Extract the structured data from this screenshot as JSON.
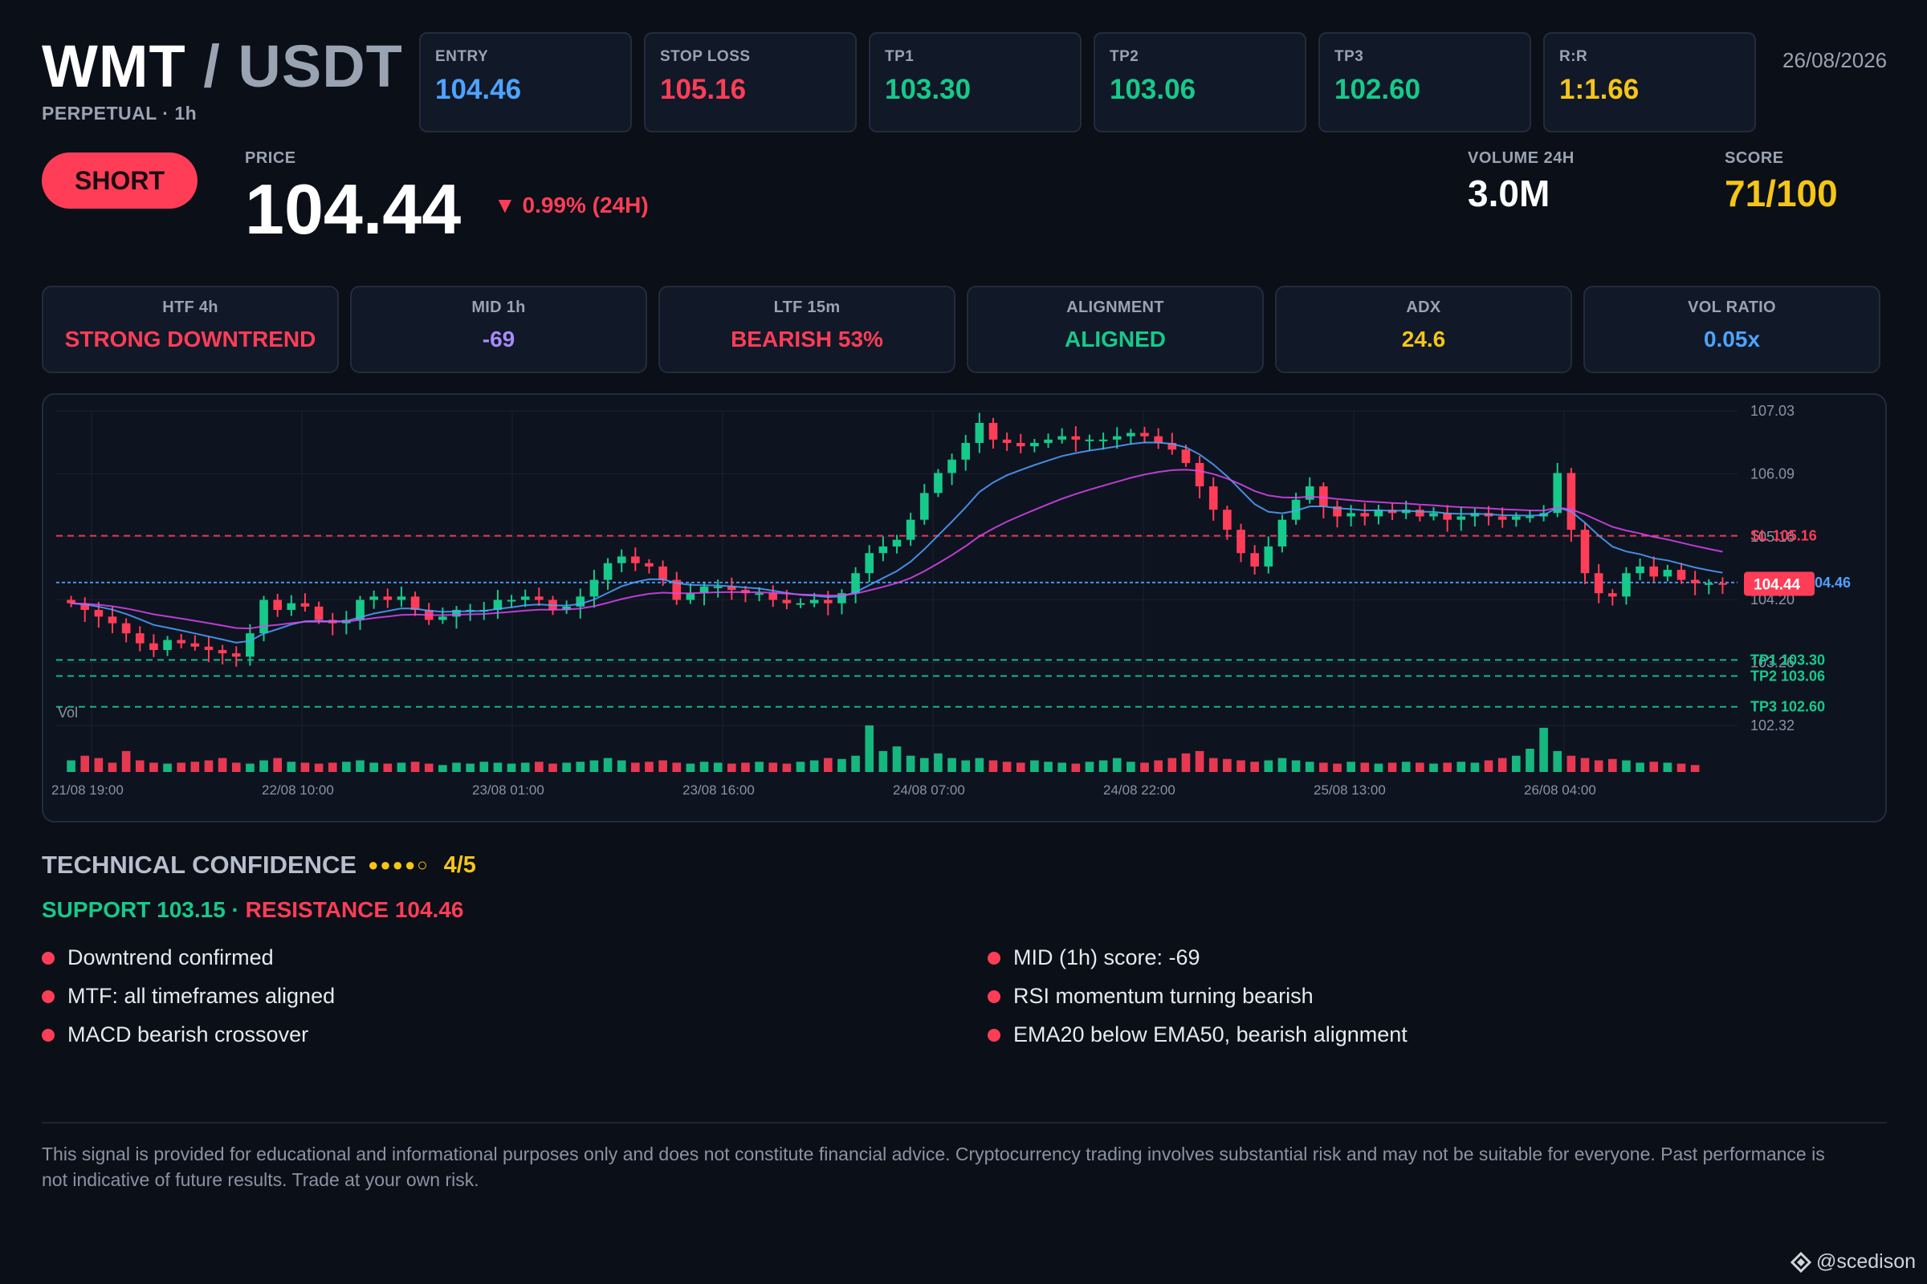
{
  "header": {
    "base": "WMT",
    "slash": "/",
    "quote": "USDT",
    "subtitle": "PERPETUAL · 1h",
    "date": "26/08/2026"
  },
  "top_cards": [
    {
      "label": "ENTRY",
      "value": "104.46",
      "color": "#4ea3ff"
    },
    {
      "label": "STOP LOSS",
      "value": "105.16",
      "color": "#ff3d57"
    },
    {
      "label": "TP1",
      "value": "103.30",
      "color": "#17c98a"
    },
    {
      "label": "TP2",
      "value": "103.06",
      "color": "#17c98a"
    },
    {
      "label": "TP3",
      "value": "102.60",
      "color": "#17c98a"
    },
    {
      "label": "R:R",
      "value": "1:1.66",
      "color": "#f5c518"
    }
  ],
  "signal": {
    "direction": "SHORT",
    "price_label": "PRICE",
    "price": "104.44",
    "change": "▼ 0.99% (24H)",
    "volume_label": "VOLUME 24H",
    "volume": "3.0M",
    "score_label": "SCORE",
    "score": "71/100"
  },
  "stats": [
    {
      "label": "HTF 4h",
      "value": "STRONG DOWNTREND",
      "color": "#ff3d57"
    },
    {
      "label": "MID 1h",
      "value": "-69",
      "color": "#a78bfa"
    },
    {
      "label": "LTF 15m",
      "value": "BEARISH 53%",
      "color": "#ff3d57"
    },
    {
      "label": "ALIGNMENT",
      "value": "ALIGNED",
      "color": "#17c98a"
    },
    {
      "label": "ADX",
      "value": "24.6",
      "color": "#f5c518"
    },
    {
      "label": "VOL RATIO",
      "value": "0.05x",
      "color": "#4ea3ff"
    }
  ],
  "chart_data": {
    "type": "candlestick",
    "y_ticks": [
      "107.03",
      "106.09",
      "105.16",
      "104.20",
      "103.26",
      "102.32"
    ],
    "y_range": [
      102.32,
      107.03
    ],
    "x_labels": [
      "21/08 19:00",
      "22/08 10:00",
      "23/08 01:00",
      "23/08 16:00",
      "24/08 07:00",
      "24/08 22:00",
      "25/08 13:00",
      "26/08 04:00"
    ],
    "volume_label": "Vol",
    "levels": [
      {
        "name": "SL",
        "label": "SL 105.16",
        "value": 105.16,
        "color": "#ff3d57"
      },
      {
        "name": "ENTRY",
        "label": "104.46",
        "value": 104.46,
        "color": "#4ea3ff"
      },
      {
        "name": "TP1",
        "label": "TP1 103.30",
        "value": 103.3,
        "color": "#17c98a"
      },
      {
        "name": "TP2",
        "label": "TP2 103.06",
        "value": 103.06,
        "color": "#17c98a"
      },
      {
        "name": "TP3",
        "label": "TP3 102.60",
        "value": 102.6,
        "color": "#17c98a"
      }
    ],
    "last_price": "104.44",
    "last_price_value": 104.44,
    "closes": [
      104.15,
      104.05,
      103.95,
      103.85,
      103.7,
      103.55,
      103.45,
      103.6,
      103.55,
      103.5,
      103.45,
      103.4,
      103.35,
      103.7,
      104.2,
      104.05,
      104.15,
      104.1,
      103.9,
      103.85,
      103.9,
      104.2,
      104.25,
      104.2,
      104.25,
      104.05,
      103.9,
      103.95,
      104.05,
      104.05,
      104.05,
      104.2,
      104.2,
      104.25,
      104.2,
      104.05,
      104.1,
      104.25,
      104.5,
      104.75,
      104.85,
      104.75,
      104.7,
      104.5,
      104.2,
      104.3,
      104.4,
      104.4,
      104.35,
      104.3,
      104.3,
      104.2,
      104.15,
      104.15,
      104.2,
      104.15,
      104.3,
      104.6,
      104.9,
      105.0,
      105.1,
      105.4,
      105.8,
      106.1,
      106.3,
      106.55,
      106.85,
      106.6,
      106.55,
      106.5,
      106.55,
      106.6,
      106.65,
      106.6,
      106.6,
      106.6,
      106.65,
      106.7,
      106.65,
      106.55,
      106.45,
      106.25,
      105.9,
      105.55,
      105.25,
      104.9,
      104.7,
      105.0,
      105.4,
      105.7,
      105.9,
      105.6,
      105.45,
      105.5,
      105.45,
      105.55,
      105.5,
      105.55,
      105.45,
      105.5,
      105.4,
      105.45,
      105.5,
      105.45,
      105.4,
      105.45,
      105.45,
      105.5,
      106.1,
      105.25,
      104.6,
      104.3,
      104.25,
      104.6,
      104.7,
      104.55,
      104.65,
      104.5,
      104.45,
      104.45,
      104.44
    ],
    "volumes": [
      0.25,
      0.35,
      0.3,
      0.2,
      0.45,
      0.25,
      0.2,
      0.18,
      0.2,
      0.22,
      0.25,
      0.3,
      0.2,
      0.18,
      0.25,
      0.3,
      0.22,
      0.2,
      0.18,
      0.2,
      0.22,
      0.25,
      0.2,
      0.18,
      0.2,
      0.22,
      0.18,
      0.15,
      0.2,
      0.18,
      0.22,
      0.2,
      0.18,
      0.2,
      0.22,
      0.18,
      0.2,
      0.22,
      0.25,
      0.3,
      0.25,
      0.2,
      0.22,
      0.25,
      0.2,
      0.18,
      0.22,
      0.2,
      0.18,
      0.2,
      0.22,
      0.2,
      0.18,
      0.22,
      0.25,
      0.3,
      0.28,
      0.35,
      1.0,
      0.45,
      0.55,
      0.35,
      0.3,
      0.4,
      0.3,
      0.25,
      0.3,
      0.25,
      0.22,
      0.2,
      0.25,
      0.22,
      0.2,
      0.18,
      0.22,
      0.25,
      0.3,
      0.22,
      0.2,
      0.25,
      0.3,
      0.4,
      0.45,
      0.3,
      0.28,
      0.25,
      0.22,
      0.25,
      0.3,
      0.25,
      0.22,
      0.2,
      0.18,
      0.22,
      0.2,
      0.18,
      0.2,
      0.22,
      0.2,
      0.18,
      0.2,
      0.22,
      0.2,
      0.25,
      0.3,
      0.35,
      0.5,
      0.95,
      0.45,
      0.35,
      0.3,
      0.25,
      0.28,
      0.25,
      0.2,
      0.22,
      0.2,
      0.18,
      0.15
    ]
  },
  "confidence": {
    "title": "TECHNICAL CONFIDENCE",
    "dots": "●●●●○",
    "score": "4/5",
    "support": "SUPPORT 103.15",
    "separator": " · ",
    "resistance": "RESISTANCE 104.46"
  },
  "reasons_left": [
    "Downtrend confirmed",
    "MTF: all timeframes aligned",
    "MACD bearish crossover"
  ],
  "reasons_right": [
    "MID (1h) score: -69",
    "RSI momentum turning bearish",
    "EMA20 below EMA50, bearish alignment"
  ],
  "disclaimer": "This signal is provided for educational and informational purposes only and does not constitute financial advice. Cryptocurrency trading involves substantial risk and may not be suitable for everyone. Past performance is not indicative of future results. Trade at your own risk.",
  "watermark": "@scedison"
}
